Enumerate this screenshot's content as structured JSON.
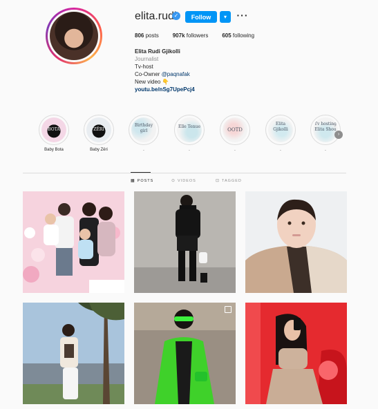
{
  "profile": {
    "username": "elita.rudi",
    "verified_icon": "✓",
    "follow_label": "Follow",
    "chevron_icon": "▾",
    "more_icon": "···",
    "stats": {
      "posts_value": "806",
      "posts_label": "posts",
      "followers_value": "907k",
      "followers_label": "followers",
      "following_value": "605",
      "following_label": "following"
    },
    "bio": {
      "full_name": "Elita Rudi Gjikolli",
      "category": "Journalist",
      "line1": "Tv-host",
      "coowner_prefix": "Co-Owner",
      "mention": "@paqnafak",
      "line3": "New video 👇",
      "link": "youtu.be/nSg7UpePcj4"
    }
  },
  "highlights": [
    {
      "label": "Baby Bota",
      "cover_text": "BOTA"
    },
    {
      "label": "Baby Zëri",
      "cover_text": "ZËRI"
    },
    {
      "label": ".",
      "cover_text": "Birthday girl"
    },
    {
      "label": ".",
      "cover_text": "Elle Tenue"
    },
    {
      "label": ".",
      "cover_text": "OOTD"
    },
    {
      "label": ".",
      "cover_text": "Elita Gjikolli"
    },
    {
      "label": ".",
      "cover_text": "Tv hosting Elita Shou"
    }
  ],
  "tabs": {
    "posts": "POSTS",
    "videos": "VIDEOS",
    "tagged": "TAGGED"
  },
  "colors": {
    "accent": "#0095f6",
    "verified": "#3897f0",
    "text": "#262626",
    "muted": "#8e8e8e"
  }
}
